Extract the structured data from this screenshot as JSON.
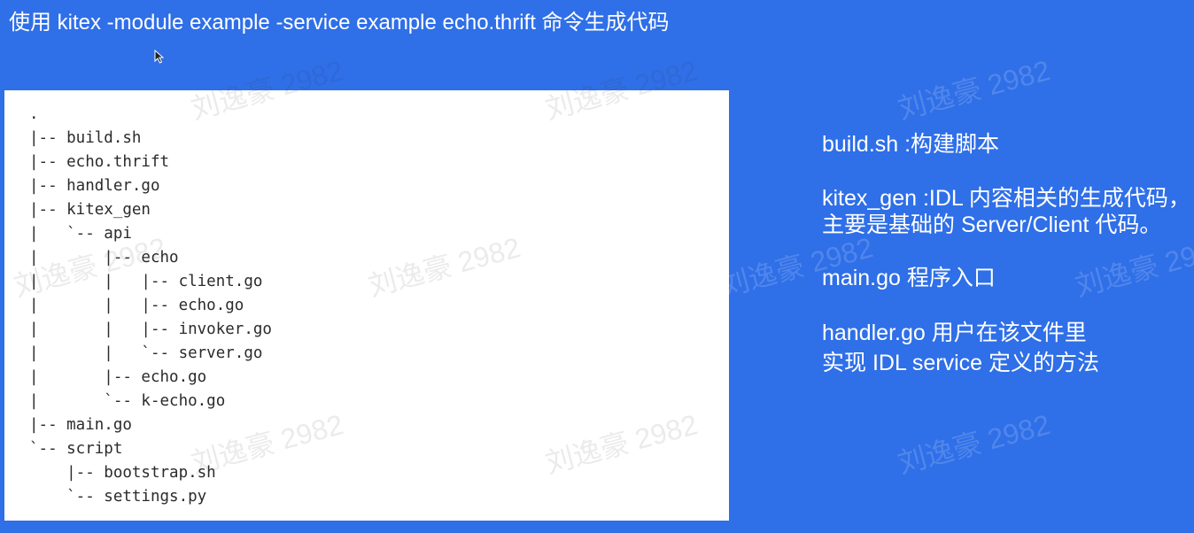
{
  "title": "使用 kitex -module example -service example echo.thrift  命令生成代码",
  "tree": [
    ".",
    "|-- build.sh",
    "|-- echo.thrift",
    "|-- handler.go",
    "|-- kitex_gen",
    "|   `-- api",
    "|       |-- echo",
    "|       |   |-- client.go",
    "|       |   |-- echo.go",
    "|       |   |-- invoker.go",
    "|       |   `-- server.go",
    "|       |-- echo.go",
    "|       `-- k-echo.go",
    "|-- main.go",
    "`-- script",
    "    |-- bootstrap.sh",
    "    `-- settings.py"
  ],
  "notes": {
    "build": "build.sh :构建脚本",
    "kitex_gen_line1": "kitex_gen :IDL 内容相关的生成代码，",
    "kitex_gen_line2": "主要是基础的 Server/Client 代码。",
    "main": "main.go 程序入口",
    "handler_line1": "handler.go 用户在该文件里",
    "handler_line2": "实现 IDL service 定义的方法"
  },
  "watermark": "刘逸豪 2982",
  "colors": {
    "background": "#2f6fe8",
    "panel": "#ffffff",
    "text": "#ffffff",
    "code": "#2b2b2b"
  }
}
